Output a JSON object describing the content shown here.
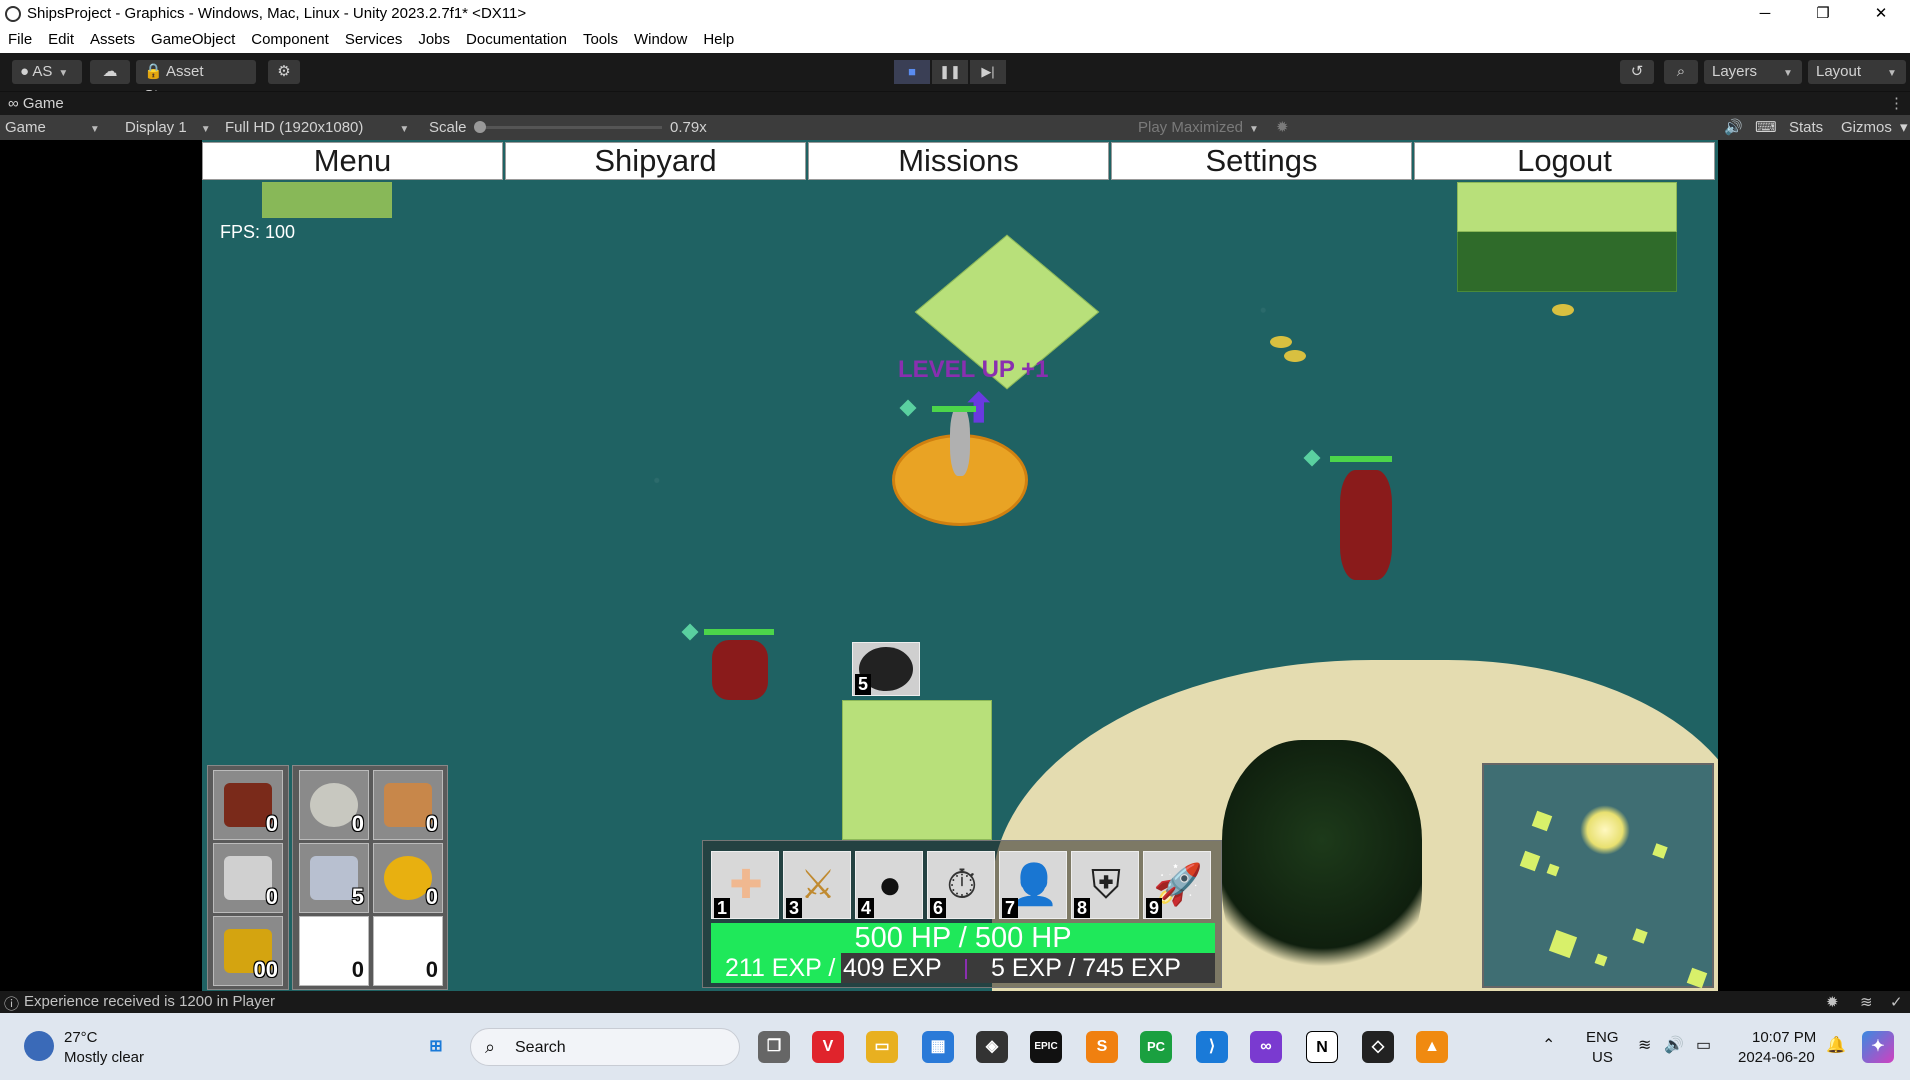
{
  "window": {
    "title": "ShipsProject - Graphics - Windows, Mac, Linux - Unity 2023.2.7f1* <DX11>",
    "controls": [
      "─",
      "❐",
      "✕"
    ]
  },
  "menu": [
    "File",
    "Edit",
    "Assets",
    "GameObject",
    "Component",
    "Services",
    "Jobs",
    "Documentation",
    "Tools",
    "Window",
    "Help"
  ],
  "toolbar": {
    "account": "AS",
    "asset_store": "Asset Store",
    "layers": "Layers",
    "layout": "Layout"
  },
  "game_view": {
    "tab": "Game",
    "mode": "Game",
    "display": "Display 1",
    "resolution": "Full HD (1920x1080)",
    "scale_label": "Scale",
    "scale_value": "0.79x",
    "play_mode": "Play Maximized",
    "stats": "Stats",
    "gizmos": "Gizmos"
  },
  "game": {
    "nav": [
      "Menu",
      "Shipyard",
      "Missions",
      "Settings",
      "Logout"
    ],
    "fps": "FPS: 100",
    "level_up": "LEVEL UP +1",
    "inventory": {
      "cannons": [
        "0",
        "0",
        "00"
      ],
      "resources": [
        "0",
        "0",
        "5",
        "0",
        "0",
        "0"
      ]
    },
    "ammo_stack": "5",
    "abilities": [
      {
        "key": "1",
        "icon": "bandage-icon"
      },
      {
        "key": "3",
        "icon": "sword-icon"
      },
      {
        "key": "4",
        "icon": "cannonball-icon"
      },
      {
        "key": "6",
        "icon": "stopwatch-icon"
      },
      {
        "key": "7",
        "icon": "add-crew-icon"
      },
      {
        "key": "8",
        "icon": "shield-icon"
      },
      {
        "key": "9",
        "icon": "rocket-icon"
      }
    ],
    "hp": "500 HP / 500 HP",
    "exp_current": "211 EXP / ",
    "exp_total": "409 EXP",
    "exp_next": "5 EXP / 745 EXP"
  },
  "status": {
    "message": "Experience received is 1200 in Player"
  },
  "taskbar": {
    "weather_temp": "27°C",
    "weather_desc": "Mostly clear",
    "search": "Search",
    "lang": "ENG",
    "region": "US",
    "time": "10:07 PM",
    "date": "2024-06-20"
  }
}
